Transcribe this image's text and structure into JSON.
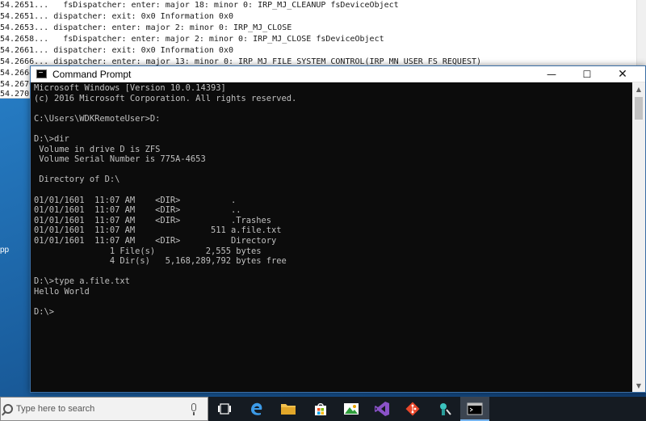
{
  "debug_log": [
    "54.2651...   fsDispatcher: enter: major 18: minor 0: IRP_MJ_CLEANUP fsDeviceObject",
    "54.2651... dispatcher: exit: 0x0 Information 0x0",
    "54.2653... dispatcher: enter: major 2: minor 0: IRP_MJ_CLOSE",
    "54.2658...   fsDispatcher: enter: major 2: minor 0: IRP_MJ_CLOSE fsDeviceObject",
    "54.2661... dispatcher: exit: 0x0 Information 0x0",
    "54.2666... dispatcher: enter: major 13: minor 0: IRP_MJ_FILE_SYSTEM_CONTROL(IRP_MN_USER_FS_REQUEST)",
    "54.2668",
    "54.2670",
    "54.2702"
  ],
  "desktop_label": "pp",
  "window": {
    "title": "Command Prompt",
    "minimize_glyph": "—",
    "maximize_glyph": "☐",
    "close_glyph": "✕"
  },
  "console_lines": [
    "Microsoft Windows [Version 10.0.14393]",
    "(c) 2016 Microsoft Corporation. All rights reserved.",
    "",
    "C:\\Users\\WDKRemoteUser>D:",
    "",
    "D:\\>dir",
    " Volume in drive D is ZFS",
    " Volume Serial Number is 775A-4653",
    "",
    " Directory of D:\\",
    "",
    "01/01/1601  11:07 AM    <DIR>          .",
    "01/01/1601  11:07 AM    <DIR>          ..",
    "01/01/1601  11:07 AM    <DIR>          .Trashes",
    "01/01/1601  11:07 AM               511 a.file.txt",
    "01/01/1601  11:07 AM    <DIR>          Directory",
    "               1 File(s)          2,555 bytes",
    "               4 Dir(s)   5,168,289,792 bytes free",
    "",
    "D:\\>type a.file.txt",
    "Hello World",
    "",
    "D:\\>"
  ],
  "taskbar": {
    "search_placeholder": "Type here to search"
  },
  "colors": {
    "console_bg": "#0c0c0c",
    "console_text": "#c0c0c0",
    "taskbar_bg": "#151b22",
    "accent": "#75b4f0"
  }
}
